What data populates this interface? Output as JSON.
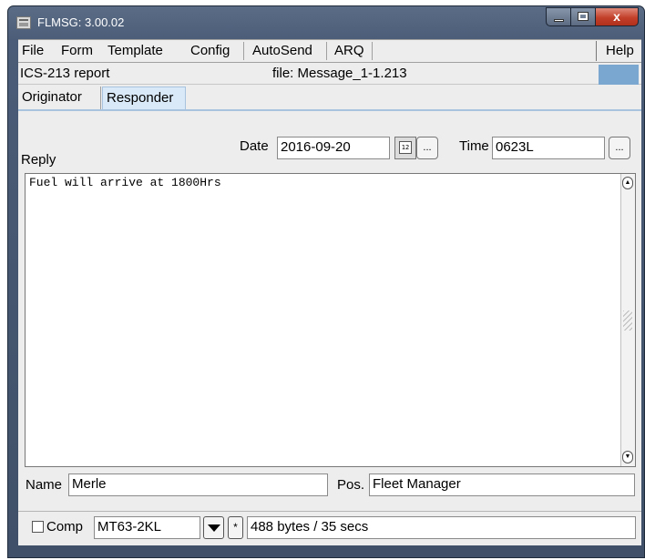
{
  "window": {
    "title": "FLMSG: 3.00.02",
    "close_glyph": "x"
  },
  "menu": {
    "items": [
      "File",
      "Form",
      "Template",
      "Config",
      "AutoSend",
      "ARQ"
    ],
    "help": "Help"
  },
  "info": {
    "form_name": "ICS-213 report",
    "file_label": "file: Message_1-1.213",
    "indicator_color": "#7aa7cf"
  },
  "tabs": {
    "originator": "Originator",
    "responder": "Responder",
    "active": "Responder"
  },
  "reply": {
    "label": "Reply",
    "date_label": "Date",
    "date_value": "2016-09-20",
    "calendar_glyph": "12",
    "dots": "...",
    "time_label": "Time",
    "time_value": "0623L",
    "text": "Fuel will arrive at 1800Hrs",
    "name_label": "Name",
    "name_value": "Merle",
    "pos_label": "Pos.",
    "pos_value": "Fleet Manager"
  },
  "status": {
    "comp_label": "Comp",
    "comp_checked": false,
    "mode": "MT63-2KL",
    "star": "*",
    "transfer": "488 bytes / 35 secs"
  }
}
